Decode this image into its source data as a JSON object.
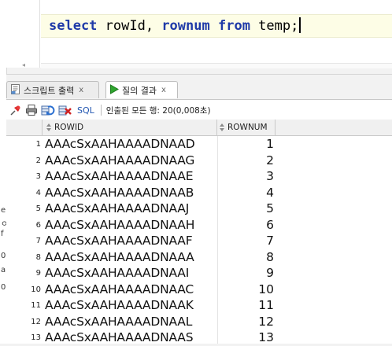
{
  "editor": {
    "code_keywords": [
      "select",
      "from"
    ],
    "code_parts": {
      "kw1": "select",
      "col1": " rowId, ",
      "col2": "rownum",
      "mid": " ",
      "kw2": "from",
      "rest": " temp;"
    }
  },
  "tabs": [
    {
      "label": "스크립트 출력",
      "close": "x",
      "icon": "script-output-icon"
    },
    {
      "label": "질의 결과",
      "close": "x",
      "icon": "run-query-icon"
    }
  ],
  "toolbar": {
    "sql_label": "SQL",
    "status": "인출된 모든 행: 20(0,008초)",
    "icons": [
      "pin-icon",
      "print-icon",
      "refresh-icon",
      "delete-icon"
    ]
  },
  "grid": {
    "columns": [
      "ROWID",
      "ROWNUM"
    ],
    "rows": [
      {
        "n": "1",
        "rowid": "AAAcSxAAHAAAADNAAD",
        "rownum": "1"
      },
      {
        "n": "2",
        "rowid": "AAAcSxAAHAAAADNAAG",
        "rownum": "2"
      },
      {
        "n": "3",
        "rowid": "AAAcSxAAHAAAADNAAE",
        "rownum": "3"
      },
      {
        "n": "4",
        "rowid": "AAAcSxAAHAAAADNAAB",
        "rownum": "4"
      },
      {
        "n": "5",
        "rowid": "AAAcSxAAHAAAADNAAJ",
        "rownum": "5"
      },
      {
        "n": "6",
        "rowid": "AAAcSxAAHAAAADNAAH",
        "rownum": "6"
      },
      {
        "n": "7",
        "rowid": "AAAcSxAAHAAAADNAAF",
        "rownum": "7"
      },
      {
        "n": "8",
        "rowid": "AAAcSxAAHAAAADNAAA",
        "rownum": "8"
      },
      {
        "n": "9",
        "rowid": "AAAcSxAAHAAAADNAAI",
        "rownum": "9"
      },
      {
        "n": "10",
        "rowid": "AAAcSxAAHAAAADNAAC",
        "rownum": "10"
      },
      {
        "n": "11",
        "rowid": "AAAcSxAAHAAAADNAAK",
        "rownum": "11"
      },
      {
        "n": "12",
        "rowid": "AAAcSxAAHAAAADNAAL",
        "rownum": "12"
      },
      {
        "n": "13",
        "rowid": "AAAcSxAAHAAAADNAAS",
        "rownum": "13"
      }
    ]
  },
  "left_fragments": [
    "e",
    "ㅇ",
    "f",
    "0",
    "a",
    "0"
  ],
  "colors": {
    "keyword": "#1f3aa8",
    "sql_link": "#2055b0",
    "current_line": "#fdfde6"
  }
}
